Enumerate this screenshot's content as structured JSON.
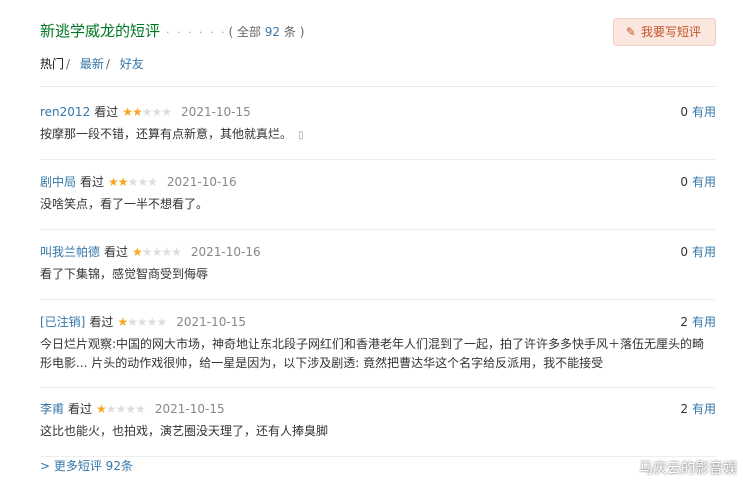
{
  "header": {
    "title": "新逃学威龙的短评",
    "dots": "· · · · · ·",
    "total_prefix": "( 全部 ",
    "total_num": "92",
    "total_suffix": " 条 )",
    "write_label": "我要写短评"
  },
  "filters": [
    {
      "label": "热门",
      "active": true
    },
    {
      "label": "最新",
      "active": false
    },
    {
      "label": "好友",
      "active": false
    }
  ],
  "reviews": [
    {
      "user": "ren2012",
      "watched": "看过",
      "rating": 2,
      "date": "2021-10-15",
      "useful_count": "0",
      "useful_label": "有用",
      "text": "按摩那一段不错，还算有点新意，其他就真烂。",
      "mobile": true
    },
    {
      "user": "剧中局",
      "watched": "看过",
      "rating": 2,
      "date": "2021-10-16",
      "useful_count": "0",
      "useful_label": "有用",
      "text": "没啥笑点，看了一半不想看了。",
      "mobile": false
    },
    {
      "user": "叫我兰帕德",
      "watched": "看过",
      "rating": 1,
      "date": "2021-10-16",
      "useful_count": "0",
      "useful_label": "有用",
      "text": "看了下集锦，感觉智商受到侮辱",
      "mobile": false
    },
    {
      "user": "[已注销]",
      "watched": "看过",
      "rating": 1,
      "date": "2021-10-15",
      "useful_count": "2",
      "useful_label": "有用",
      "text": "今日烂片观察:中国的网大市场，神奇地让东北段子网红们和香港老年人们混到了一起，拍了许许多多快手风＋落伍无厘头的畸形电影... 片头的动作戏很帅，给一星是因为，以下涉及剧透: 竟然把曹达华这个名字给反派用，我不能接受",
      "mobile": false
    },
    {
      "user": "李甫",
      "watched": "看过",
      "rating": 1,
      "date": "2021-10-15",
      "useful_count": "2",
      "useful_label": "有用",
      "text": "这比也能火，也拍戏，演艺圈没天理了，还有人捧臭脚",
      "mobile": false
    }
  ],
  "more_link": "> 更多短评 92条",
  "watermark": "马庆云的影音娱",
  "colors": {
    "accent_link": "#3377aa",
    "title_green": "#007722",
    "star": "#f5a623",
    "button_bg": "#fbe7df"
  }
}
